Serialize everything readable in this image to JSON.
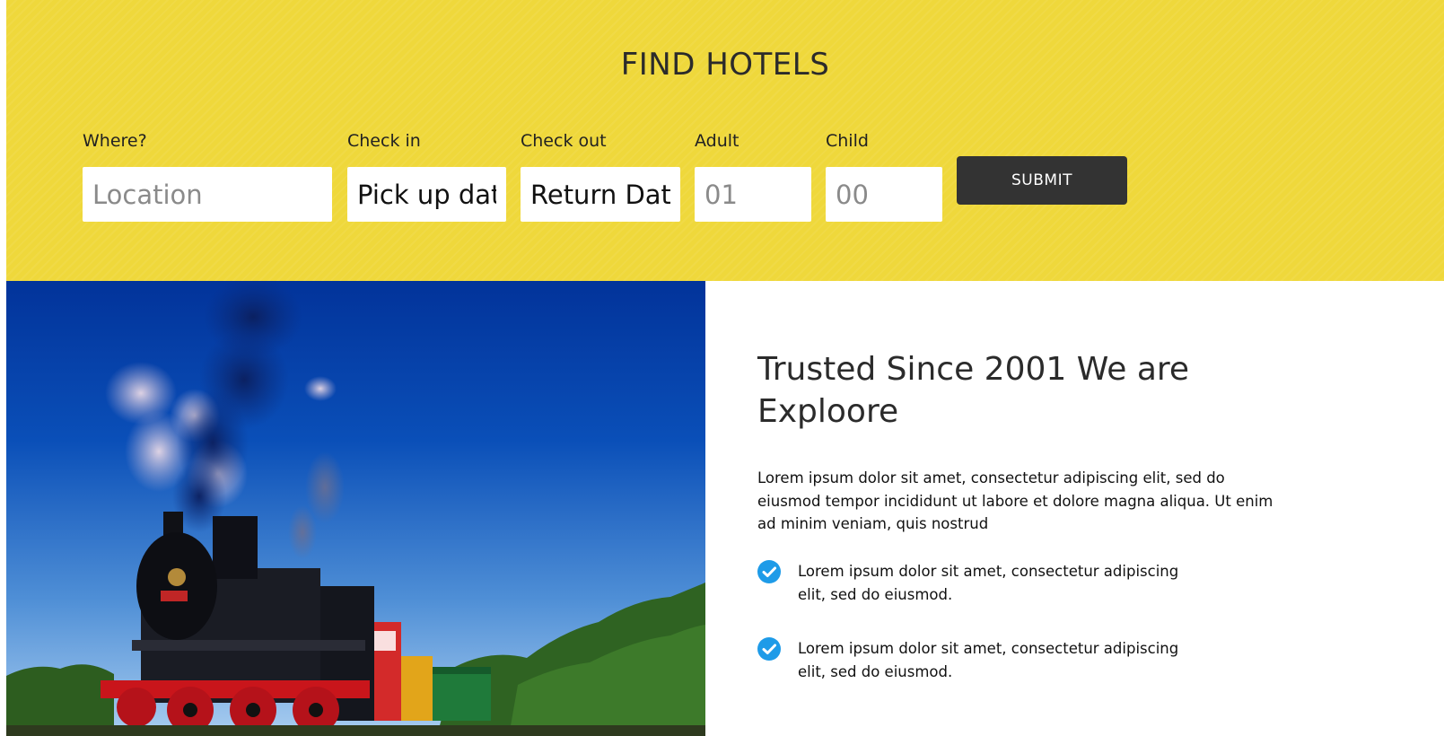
{
  "search": {
    "title": "FIND HOTELS",
    "fields": [
      {
        "label": "Where?",
        "placeholder": "Location",
        "value": ""
      },
      {
        "label": "Check in",
        "placeholder": "Pick up date",
        "value": ""
      },
      {
        "label": "Check out",
        "placeholder": "Return Date",
        "value": ""
      },
      {
        "label": "Adult",
        "placeholder": "01",
        "value": ""
      },
      {
        "label": "Child",
        "placeholder": "00",
        "value": ""
      }
    ],
    "submit_label": "SUBMIT"
  },
  "about": {
    "heading": "Trusted Since 2001 We are Exploore",
    "paragraph": "Lorem ipsum dolor sit amet, consectetur adipiscing elit, sed do eiusmod tempor incididunt ut labore et dolore magna aliqua. Ut enim ad minim veniam, quis nostrud",
    "features": [
      {
        "text": "Lorem ipsum dolor sit amet, consectetur adipiscing elit, sed do eiusmod."
      },
      {
        "text": "Lorem ipsum dolor sit amet, consectetur adipiscing elit, sed do eiusmod."
      }
    ]
  },
  "image": {
    "icon": "steam-locomotive-photo"
  },
  "colors": {
    "band": "#efd83b",
    "button": "#333333",
    "check": "#1e9be8"
  }
}
